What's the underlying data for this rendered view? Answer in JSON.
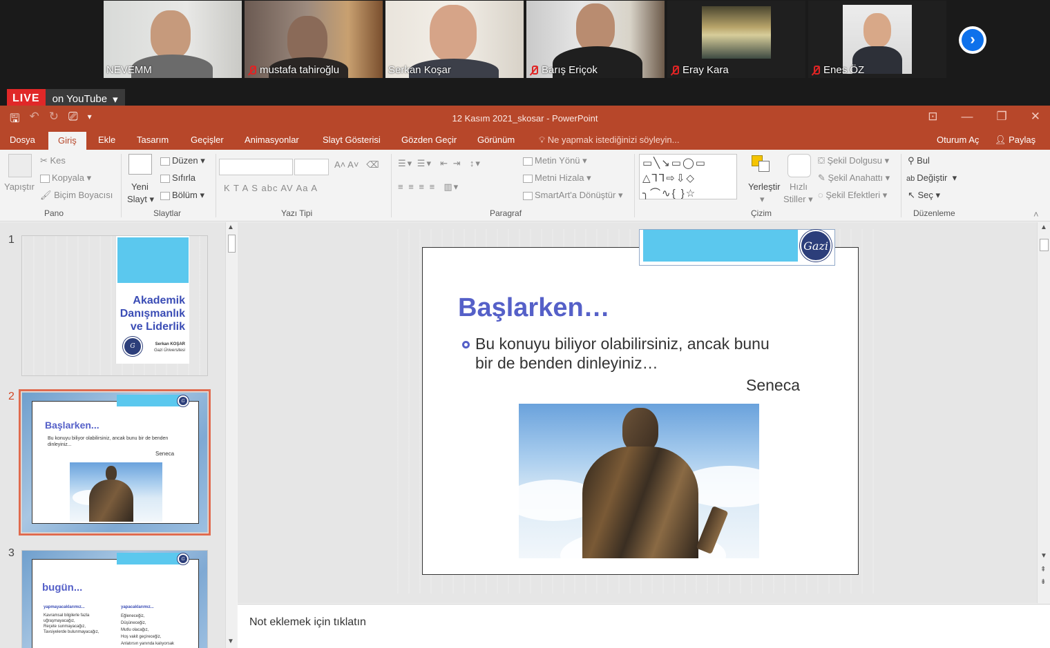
{
  "participants": [
    {
      "name": "NEVEMM",
      "muted": false
    },
    {
      "name": "mustafa tahiroğlu",
      "muted": true
    },
    {
      "name": "Serkan Koşar",
      "muted": false
    },
    {
      "name": "Barış Eriçok",
      "muted": true
    },
    {
      "name": "Eray Kara",
      "muted": true
    },
    {
      "name": "Enes ÖZ",
      "muted": true
    }
  ],
  "live": {
    "badge": "LIVE",
    "platform": "on YouTube",
    "caret": "▾"
  },
  "window": {
    "title": "12 Kasım 2021_skosar  -  PowerPoint"
  },
  "tabs": [
    "Dosya",
    "Giriş",
    "Ekle",
    "Tasarım",
    "Geçişler",
    "Animasyonlar",
    "Slayt Gösterisi",
    "Gözden Geçir",
    "Görünüm"
  ],
  "active_tab": "Giriş",
  "tell_me": "Ne yapmak istediğinizi söyleyin...",
  "sign_in": "Oturum Aç",
  "share": "Paylaş",
  "ribbon": {
    "pano": {
      "label": "Pano",
      "paste": "Yapıştır",
      "cut": "Kes",
      "copy": "Kopyala",
      "format_painter": "Biçim Boyacısı"
    },
    "slaytlar": {
      "label": "Slaytlar",
      "new_slide_1": "Yeni",
      "new_slide_2": "Slayt",
      "layout": "Düzen",
      "reset": "Sıfırla",
      "section": "Bölüm"
    },
    "yazi_tipi": {
      "label": "Yazı Tipi",
      "format_buttons": "K   T   A   S   abc   AV   Aa   A"
    },
    "paragraf": {
      "label": "Paragraf",
      "text_direction": "Metin Yönü",
      "align_text": "Metni Hizala",
      "smartart": "SmartArt'a Dönüştür"
    },
    "cizim": {
      "label": "Çizim",
      "arrange": "Yerleştir",
      "quick_styles_1": "Hızlı",
      "quick_styles_2": "Stiller",
      "fill": "Şekil Dolgusu",
      "outline": "Şekil Anahattı",
      "effects": "Şekil Efektleri"
    },
    "duzenleme": {
      "label": "Düzenleme",
      "find": "Bul",
      "replace": "Değiştir",
      "select": "Seç"
    }
  },
  "thumbnails": [
    {
      "num": "1",
      "title_lines": [
        "Akademik",
        "Danışmanlık",
        "ve Liderlik"
      ],
      "author": "Serkan KOŞAR",
      "affiliation": "Gazi Üniversitesi"
    },
    {
      "num": "2",
      "title": "Başlarken...",
      "bullet": "Bu konuyu biliyor olabilirsiniz, ancak bunu bir de benden dinleyiniz...",
      "attribution": "Seneca"
    },
    {
      "num": "3",
      "title": "bugün...",
      "left_heading": "yapmayacaklarımız...",
      "right_heading": "yapacaklarımız...",
      "left_items": [
        "Kavramsal bilgilerle fazla uğraşmayacağız,",
        "Reçete sunmayacağız,",
        "Tavsiyelerde bulunmayacağız,"
      ],
      "right_items": [
        "Eğleneceğiz,",
        "Düşüneceğiz,",
        "Mutlu olacağız,",
        "Hoş vakit geçireceğiz,",
        "Anlatırsın yanında kalıyorsak"
      ]
    }
  ],
  "slide": {
    "title": "Başlarken…",
    "bullet_line1": "Bu konuyu biliyor olabilirsiniz, ancak bunu",
    "bullet_line2": "bir de benden dinleyiniz…",
    "attribution": "Seneca"
  },
  "notes_placeholder": "Not eklemek için tıklatın",
  "colors": {
    "accent": "#b7472a",
    "title_blue": "#5560c8",
    "bar_cyan": "#5bc8ee",
    "live_red": "#e02828",
    "zoom_blue": "#0e71eb"
  }
}
